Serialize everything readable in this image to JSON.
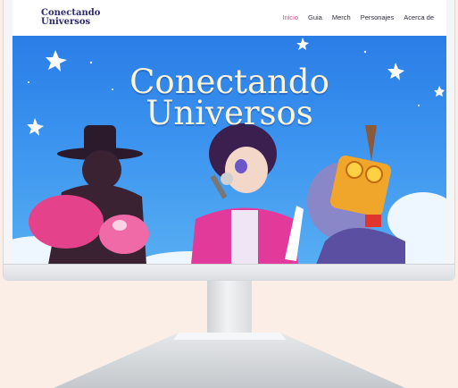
{
  "brand": {
    "line1": "Conectando",
    "line2": "Universos"
  },
  "nav": {
    "items": [
      {
        "label": "Inicio",
        "active": true
      },
      {
        "label": "Guia",
        "active": false
      },
      {
        "label": "Merch",
        "active": false
      },
      {
        "label": "Personajes",
        "active": false
      },
      {
        "label": "Acerca de",
        "active": false
      }
    ]
  },
  "hero": {
    "title_line1": "Conectando",
    "title_line2": "Universos"
  },
  "colors": {
    "accent": "#e0479a",
    "brand": "#2f2a6b",
    "sky": "#2a7de6",
    "title": "#fff4d8",
    "background": "#fbeee6"
  }
}
